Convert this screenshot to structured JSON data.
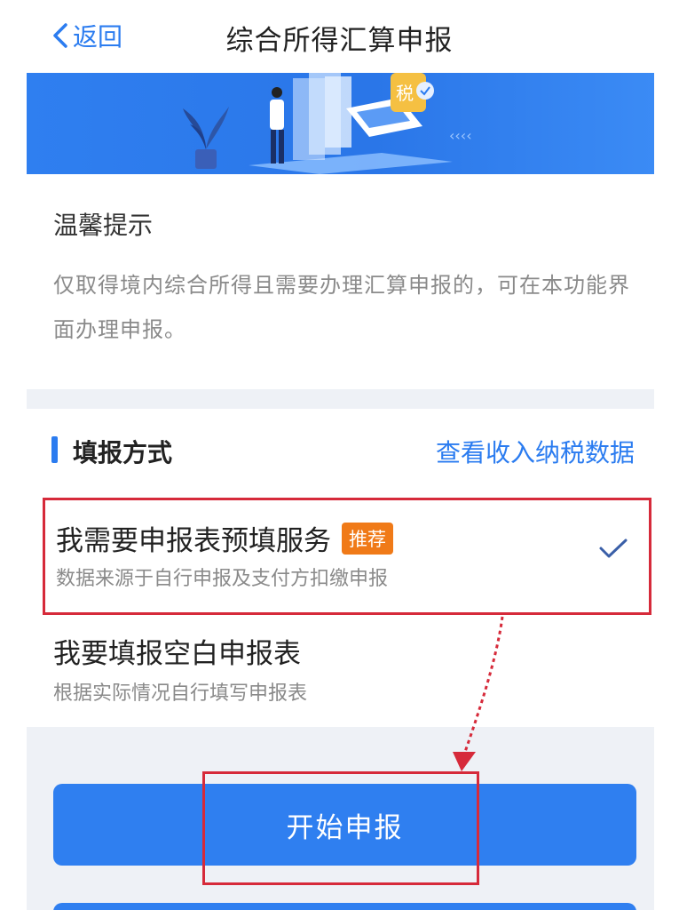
{
  "header": {
    "back_label": "返回",
    "title": "综合所得汇算申报"
  },
  "tip": {
    "title": "温馨提示",
    "text": "仅取得境内综合所得且需要办理汇算申报的，可在本功能界面办理申报。"
  },
  "section": {
    "title": "填报方式",
    "link": "查看收入纳税数据"
  },
  "options": [
    {
      "title": "我需要申报表预填服务",
      "badge": "推荐",
      "subtitle": "数据来源于自行申报及支付方扣缴申报",
      "selected": true
    },
    {
      "title": "我要填报空白申报表",
      "subtitle": "根据实际情况自行填写申报表",
      "selected": false
    }
  ],
  "start_button": "开始申报",
  "banner": {
    "tax_label": "税"
  },
  "colors": {
    "accent": "#2b7cf0",
    "highlight": "#d62a3a",
    "badge": "#f07a18"
  }
}
